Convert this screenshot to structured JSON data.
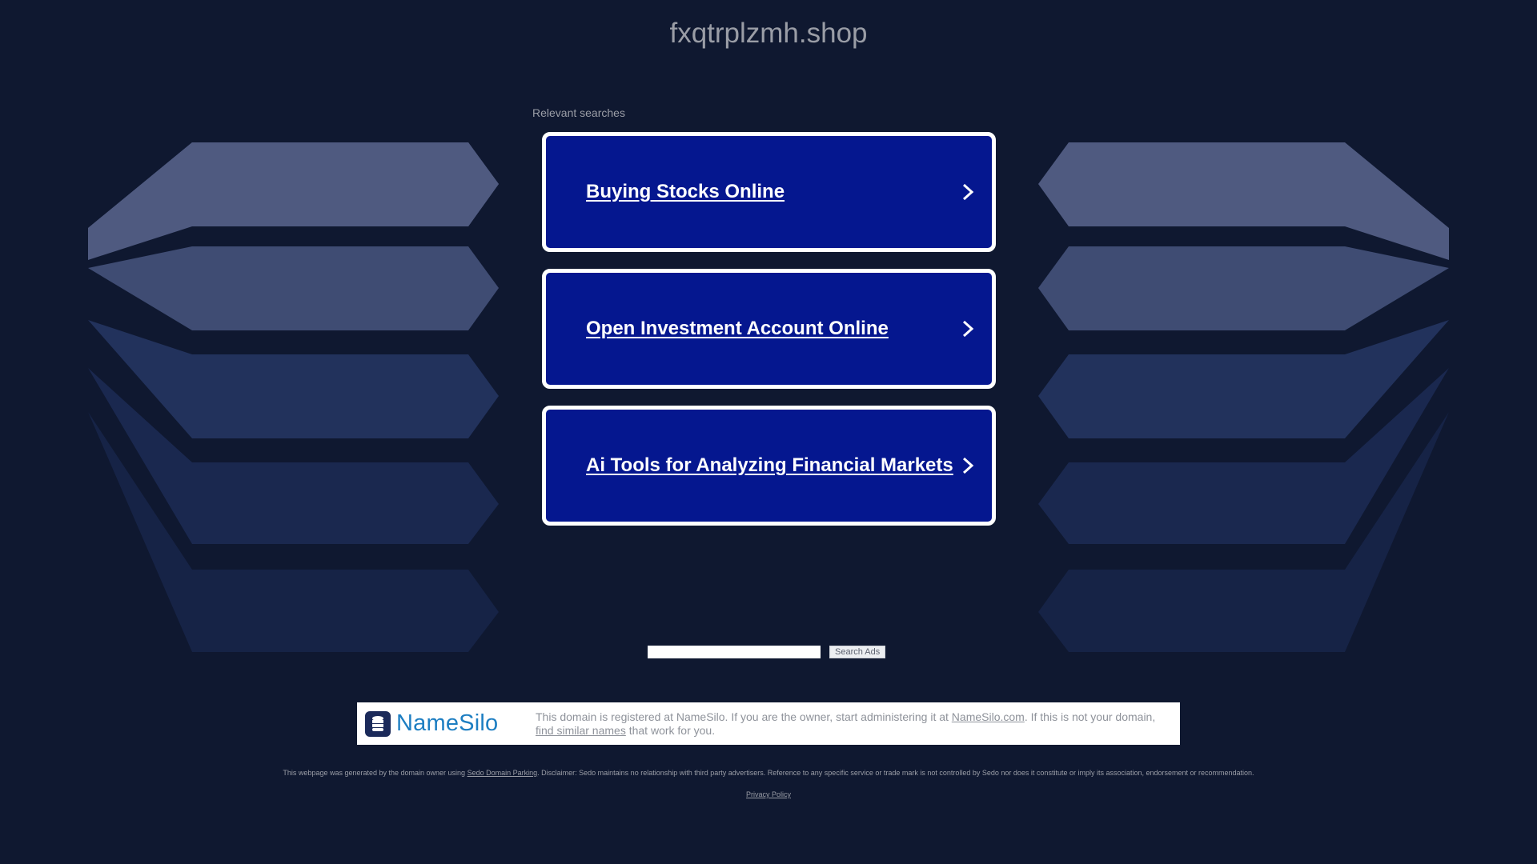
{
  "page": {
    "domain": "fxqtrplzmh.shop",
    "relevant_searches_label": "Relevant searches"
  },
  "searches": [
    {
      "label": "Buying Stocks Online"
    },
    {
      "label": "Open Investment Account Online"
    },
    {
      "label": "Ai Tools for Analyzing Financial Markets"
    }
  ],
  "search_box": {
    "value": "",
    "button_label": "Search Ads"
  },
  "registrar": {
    "logo_text": "NameSilo",
    "text_before_link": "This domain is registered at NameSilo. If you are the owner, start administering it at ",
    "link_namesilo": "NameSilo.com",
    "text_middle": ". If this is not your domain, ",
    "link_similar": "find similar names",
    "text_after": " that work for you."
  },
  "footer": {
    "disclaimer_prefix": "This webpage was generated by the domain owner using ",
    "disclaimer_link": "Sedo Domain Parking",
    "disclaimer_suffix": ". Disclaimer: Sedo maintains no relationship with third party advertisers. Reference to any specific service or trade mark is not controlled by Sedo nor does it constitute or imply its association, endorsement or recommendation.",
    "privacy_policy": "Privacy Policy"
  },
  "colors": {
    "background": "#0f1830",
    "card_background": "#05178f",
    "card_border": "#ffffff",
    "muted_text": "#9a9da6",
    "namesilo_blue": "#1d7ec2"
  }
}
